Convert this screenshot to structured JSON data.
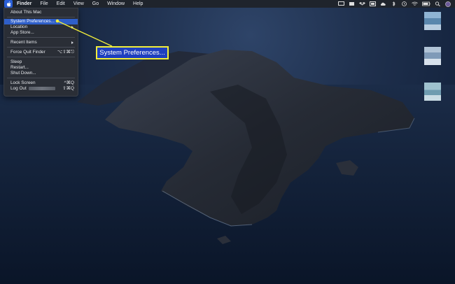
{
  "menubar": {
    "app_name": "Finder",
    "menus": [
      "File",
      "Edit",
      "View",
      "Go",
      "Window",
      "Help"
    ]
  },
  "status_icons": [
    "screen-mirror-icon",
    "cast-icon",
    "dropbox-icon",
    "display-icon",
    "cloud-icon",
    "bluetooth-icon",
    "time-machine-icon",
    "wifi-icon",
    "battery-icon",
    "search-icon",
    "user-icon"
  ],
  "apple_menu": {
    "about": "About This Mac",
    "system_preferences": "System Preferences...",
    "location": "Location",
    "app_store": "App Store...",
    "recent_items": "Recent Items",
    "force_quit": "Force Quit Finder",
    "force_quit_shortcut": "⌥⇧⌘⎋",
    "sleep": "Sleep",
    "restart": "Restart...",
    "shut_down": "Shut Down...",
    "lock_screen": "Lock Screen",
    "lock_screen_shortcut": "^⌘Q",
    "log_out": "Log Out",
    "log_out_shortcut": "⇧⌘Q"
  },
  "callout": {
    "label": "System Preferences...",
    "color": "#f2ee3b"
  },
  "colors": {
    "highlight": "#2f5fc9",
    "callout_bg": "#1e3fbf",
    "menubar_bg": "#1f242c"
  }
}
